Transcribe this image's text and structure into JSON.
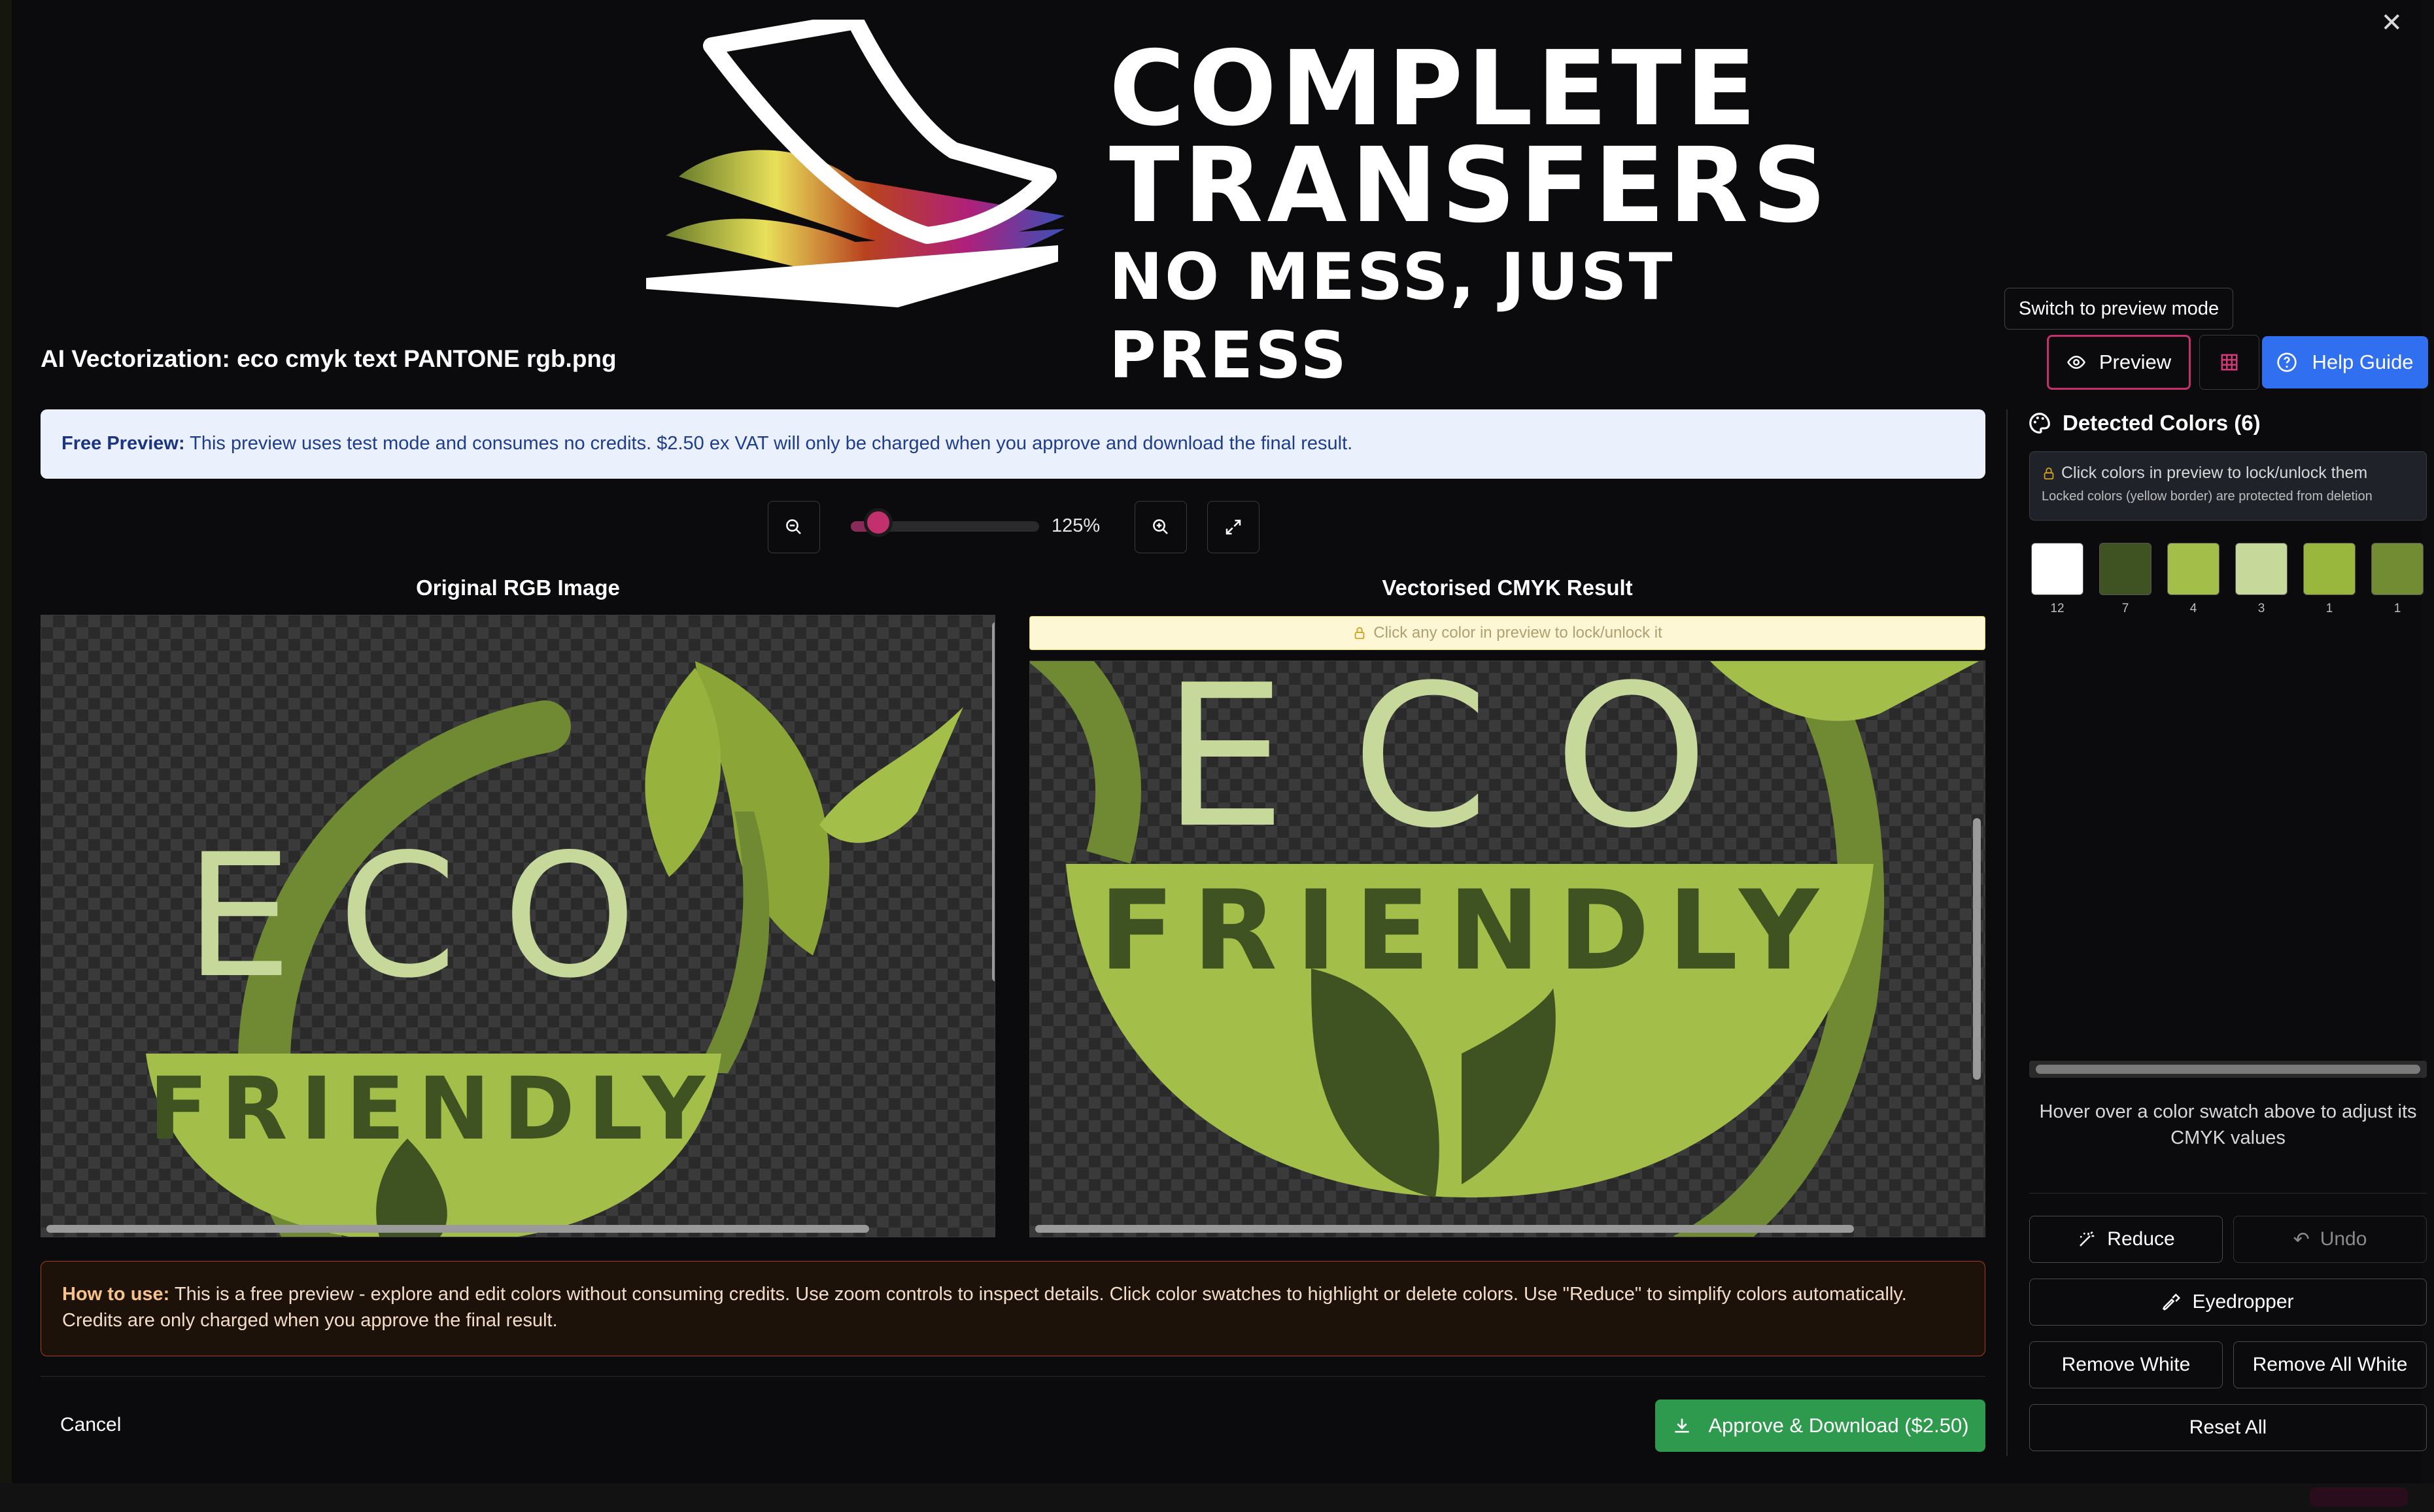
{
  "dialog": {
    "title": "AI Vectorization: eco cmyk text PANTONE rgb.png",
    "close_icon": "close-icon"
  },
  "logo": {
    "line1": "COMPLETE",
    "line2": "TRANSFERS",
    "line3": "NO MESS, JUST PRESS"
  },
  "toolbar": {
    "tooltip": "Switch to preview mode",
    "preview_label": "Preview",
    "help_label": "Help Guide"
  },
  "banner": {
    "bold": "Free Preview:",
    "text": " This preview uses test mode and consumes no credits. $2.50 ex VAT will only be charged when you approve and download the final result."
  },
  "zoom": {
    "value": 125,
    "min": 100,
    "max": 400,
    "label": "125%"
  },
  "panels": {
    "original_title": "Original RGB Image",
    "result_title": "Vectorised CMYK Result",
    "lock_hint": "Click any color in preview to lock/unlock it"
  },
  "artwork": {
    "word1": "ECO",
    "word2": "FRIENDLY"
  },
  "howto": {
    "bold": "How to use:",
    "text": " This is a free preview - explore and edit colors without consuming credits. Use zoom controls to inspect details. Click color swatches to highlight or delete colors. Use \"Reduce\" to simplify colors automatically. Credits are only charged when you approve the final result."
  },
  "footer": {
    "cancel_label": "Cancel",
    "approve_label": "Approve & Download ($2.50)"
  },
  "sidebar": {
    "title": "Detected Colors (6)",
    "info_line1": "Click colors in preview to lock/unlock them",
    "info_line2": "Locked colors (yellow border) are protected from deletion",
    "swatches": [
      {
        "color": "#ffffff",
        "count": "12"
      },
      {
        "color": "#3f5221",
        "count": "7"
      },
      {
        "color": "#a3bf4a",
        "count": "4"
      },
      {
        "color": "#c6d99a",
        "count": "3"
      },
      {
        "color": "#99b63d",
        "count": "1"
      },
      {
        "color": "#718c33",
        "count": "1"
      }
    ],
    "hover_hint": "Hover over a color swatch above to adjust its CMYK values",
    "reduce_label": "Reduce",
    "undo_label": "Undo",
    "eyedropper_label": "Eyedropper",
    "remove_white_label": "Remove White",
    "remove_all_white_label": "Remove All White",
    "reset_all_label": "Reset All"
  }
}
